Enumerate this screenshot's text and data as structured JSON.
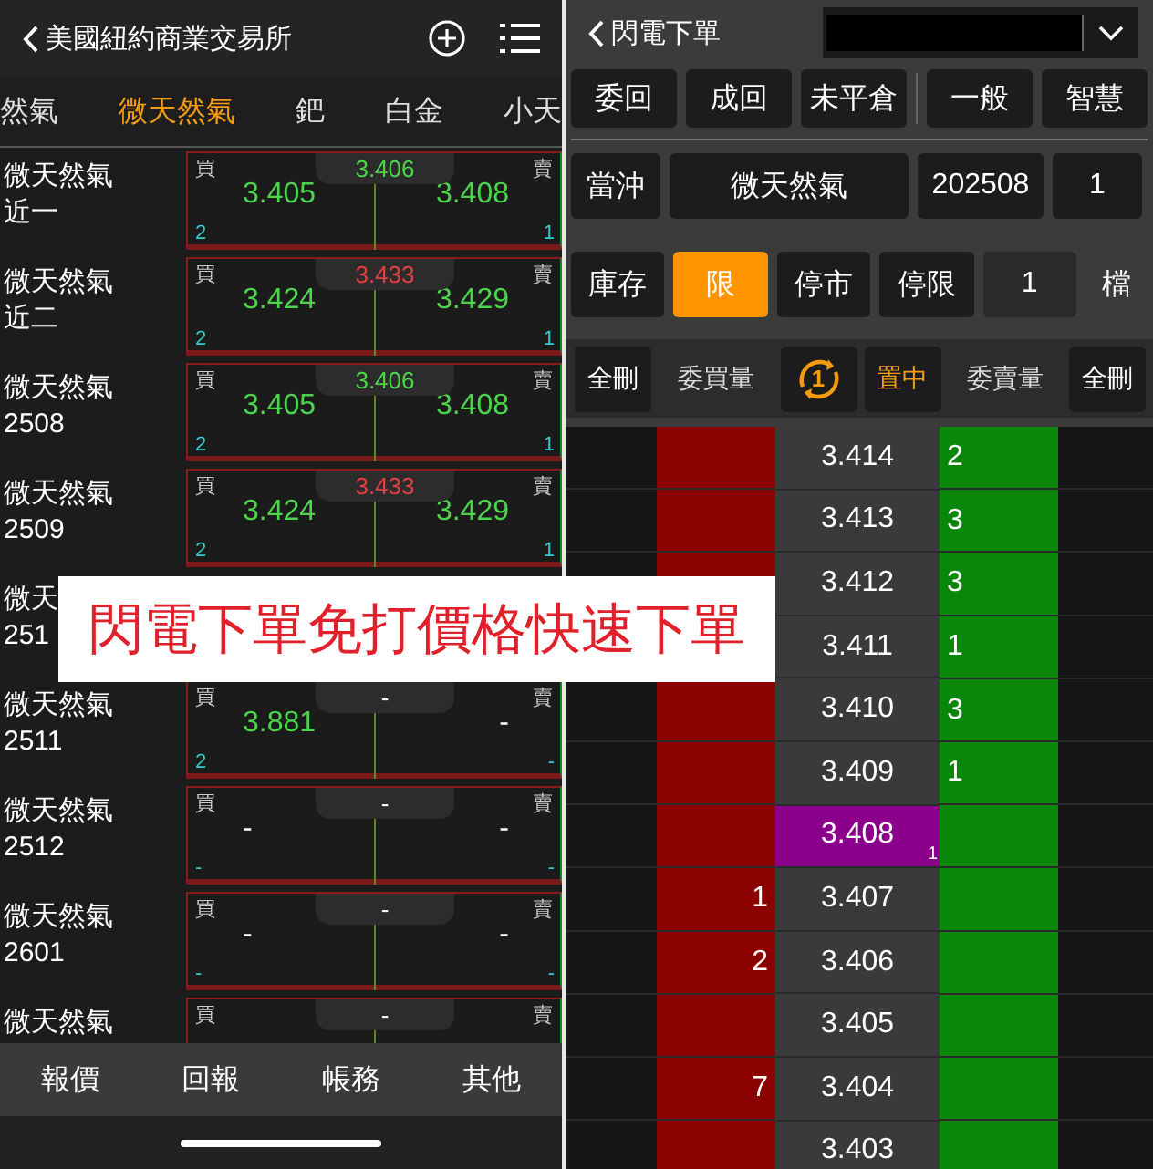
{
  "market_screen": {
    "back_title": "美國紐約商業交易所",
    "tabs": [
      {
        "label": "然氣",
        "selected": false
      },
      {
        "label": "微天然氣",
        "selected": true
      },
      {
        "label": "鈀",
        "selected": false
      },
      {
        "label": "白金",
        "selected": false
      },
      {
        "label": "小天",
        "selected": false
      }
    ],
    "rows": [
      {
        "name": [
          "微天然氣",
          "近一"
        ],
        "quote": {
          "buy_label": "買",
          "sell_label": "賣",
          "last": {
            "text": "3.406",
            "color": "#4cd44c"
          },
          "bid": {
            "price": "3.405",
            "qty": "2",
            "color": "#4cd44c"
          },
          "ask": {
            "price": "3.408",
            "qty": "1",
            "color": "#4cd44c"
          }
        }
      },
      {
        "name": [
          "微天然氣",
          "近二"
        ],
        "quote": {
          "buy_label": "買",
          "sell_label": "賣",
          "last": {
            "text": "3.433",
            "color": "#e04040"
          },
          "bid": {
            "price": "3.424",
            "qty": "2",
            "color": "#4cd44c"
          },
          "ask": {
            "price": "3.429",
            "qty": "1",
            "color": "#4cd44c"
          }
        }
      },
      {
        "name": [
          "微天然氣",
          "2508"
        ],
        "quote": {
          "buy_label": "買",
          "sell_label": "賣",
          "last": {
            "text": "3.406",
            "color": "#4cd44c"
          },
          "bid": {
            "price": "3.405",
            "qty": "2",
            "color": "#4cd44c"
          },
          "ask": {
            "price": "3.408",
            "qty": "1",
            "color": "#4cd44c"
          }
        }
      },
      {
        "name": [
          "微天然氣",
          "2509"
        ],
        "quote": {
          "buy_label": "買",
          "sell_label": "賣",
          "last": {
            "text": "3.433",
            "color": "#e04040"
          },
          "bid": {
            "price": "3.424",
            "qty": "2",
            "color": "#4cd44c"
          },
          "ask": {
            "price": "3.429",
            "qty": "1",
            "color": "#4cd44c"
          }
        }
      },
      {
        "name": [
          "微天",
          "251"
        ]
      },
      {
        "name": [
          "微天然氣",
          "2511"
        ],
        "quote": {
          "buy_label": "買",
          "sell_label": "賣",
          "last": {
            "text": "-",
            "color": "#ffffff"
          },
          "bid": {
            "price": "3.881",
            "qty": "2",
            "color": "#4cd44c"
          },
          "ask": {
            "price": "-",
            "qty": "-",
            "color": "#ffffff"
          }
        }
      },
      {
        "name": [
          "微天然氣",
          "2512"
        ],
        "quote": {
          "buy_label": "買",
          "sell_label": "賣",
          "last": {
            "text": "-",
            "color": "#ffffff"
          },
          "bid": {
            "price": "-",
            "qty": "-",
            "color": "#ffffff"
          },
          "ask": {
            "price": "-",
            "qty": "-",
            "color": "#ffffff"
          }
        }
      },
      {
        "name": [
          "微天然氣",
          "2601"
        ],
        "quote": {
          "buy_label": "買",
          "sell_label": "賣",
          "last": {
            "text": "-",
            "color": "#ffffff"
          },
          "bid": {
            "price": "-",
            "qty": "-",
            "color": "#ffffff"
          },
          "ask": {
            "price": "-",
            "qty": "-",
            "color": "#ffffff"
          }
        }
      },
      {
        "name": [
          "微天然氣"
        ],
        "quote": {
          "buy_label": "買",
          "sell_label": "賣",
          "last": {
            "text": "-",
            "color": "#ffffff"
          }
        }
      }
    ],
    "bottom_nav": [
      "報價",
      "回報",
      "帳務",
      "其他"
    ]
  },
  "order_screen": {
    "back_title": "閃電下單",
    "view_buttons": [
      "委回",
      "成回",
      "未平倉"
    ],
    "mode_buttons": [
      "一般",
      "智慧"
    ],
    "day_trade": "當沖",
    "product": "微天然氣",
    "month": "202508",
    "quantity": "1",
    "inventory": "庫存",
    "price_types": [
      {
        "label": "限",
        "selected": true
      },
      {
        "label": "停市",
        "selected": false
      },
      {
        "label": "停限",
        "selected": false
      }
    ],
    "ticks": "1",
    "ticks_unit": "檔",
    "ladder_header": {
      "delete_buy": "全刪",
      "buy_qty": "委買量",
      "refresh_count": "1",
      "center": "置中",
      "sell_qty": "委賣量",
      "delete_sell": "全刪"
    },
    "ladder": [
      {
        "price": "3.414",
        "ask": "2",
        "last_trade": false
      },
      {
        "price": "3.413",
        "ask": "3",
        "last_trade": false
      },
      {
        "price": "3.412",
        "ask": "3",
        "last_trade": false
      },
      {
        "price": "3.411",
        "ask": "1",
        "last_trade": false
      },
      {
        "price": "3.410",
        "ask": "3",
        "last_trade": false
      },
      {
        "price": "3.409",
        "ask": "1",
        "last_trade": false
      },
      {
        "price": "3.408",
        "last_trade": true,
        "trade_qty": "1"
      },
      {
        "price": "3.407",
        "bid": "1",
        "last_trade": false
      },
      {
        "price": "3.406",
        "bid": "2",
        "last_trade": false
      },
      {
        "price": "3.405",
        "last_trade": false
      },
      {
        "price": "3.404",
        "bid": "7",
        "last_trade": false
      },
      {
        "price": "3.403",
        "last_trade": false
      }
    ]
  },
  "caption": "閃電下單免打價格快速下單"
}
